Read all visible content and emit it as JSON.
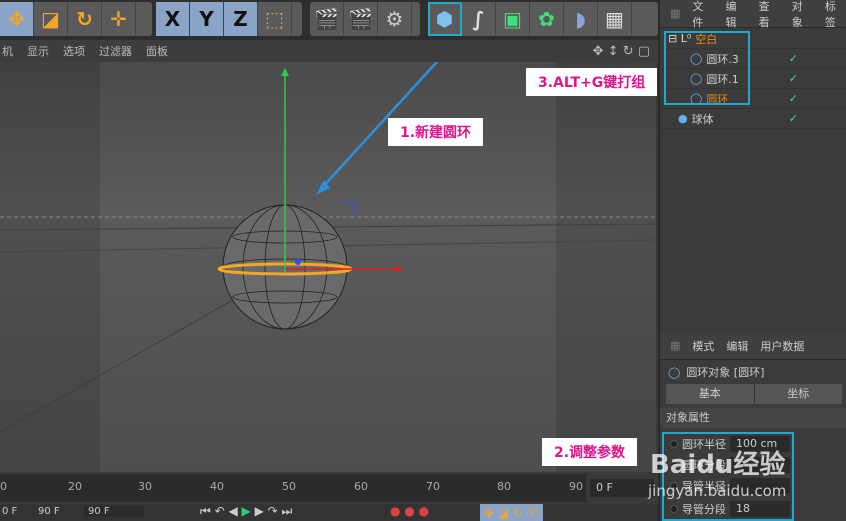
{
  "toolbar": {
    "axis_x": "X",
    "axis_y": "Y",
    "axis_z": "Z"
  },
  "viewport_menu": [
    "机",
    "显示",
    "选项",
    "过滤器",
    "面板"
  ],
  "object_manager": {
    "menu": [
      "文件",
      "编辑",
      "查看",
      "对象",
      "标签"
    ],
    "objects": [
      {
        "name": "空白",
        "level": 0,
        "color": "#e08a1a"
      },
      {
        "name": "圆环.3",
        "level": 1,
        "color": "#bbbbbb"
      },
      {
        "name": "圆环.1",
        "level": 1,
        "color": "#bbbbbb"
      },
      {
        "name": "圆环",
        "level": 1,
        "color": "#e08a1a"
      },
      {
        "name": "球体",
        "level": 0,
        "color": "#bbbbbb"
      }
    ]
  },
  "attribute_manager": {
    "menu": [
      "模式",
      "编辑",
      "用户数据"
    ],
    "object_title": "圆环对象 [圆环]",
    "tabs": [
      "基本",
      "坐标"
    ],
    "section": "对象属性",
    "params": [
      {
        "label": "圆环半径",
        "value": "100 cm"
      },
      {
        "label": "圆环分段",
        "value": ""
      },
      {
        "label": "导管半径",
        "value": ""
      },
      {
        "label": "导管分段",
        "value": "18"
      }
    ]
  },
  "callouts": {
    "step1": "1.新建圆环",
    "step2": "2.调整参数",
    "step3": "3.ALT+G键打组"
  },
  "timeline": {
    "ticks": [
      "0",
      "20",
      "30",
      "40",
      "50",
      "60",
      "70",
      "80",
      "90"
    ],
    "current_frame": "0 F",
    "range_start": "0 F",
    "range_end": "90 F",
    "end_frame": "90 F"
  },
  "watermark": {
    "brand": "Baidu经验",
    "url": "jingyan.baidu.com"
  }
}
